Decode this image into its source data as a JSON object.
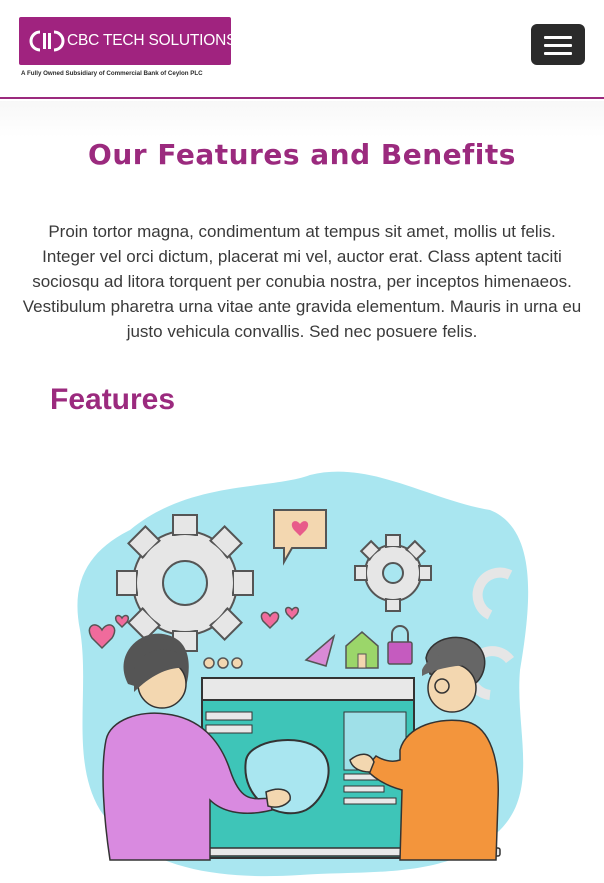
{
  "header": {
    "logo_text": "CBC TECH SOLUTIONS",
    "logo_tagline": "A Fully Owned Subsidiary of Commercial Bank of Ceylon PLC",
    "menu_icon": "hamburger-icon"
  },
  "main": {
    "title": "Our Features and Benefits",
    "intro": "Proin tortor magna, condimentum at tempus sit amet, mollis ut felis. Integer vel orci dictum, placerat mi vel, auctor erat. Class aptent taciti sociosqu ad litora torquent per conubia nostra, per inceptos himenaeos. Vestibulum pharetra urna vitae ante gravida elementum. Mauris in urna eu justo vehicula convallis. Sed nec posuere felis.",
    "features_heading": "Features"
  },
  "colors": {
    "brand": "#9b2a7e",
    "menu_button": "#2b2b2b",
    "illustration_background": "#a9e6f0"
  }
}
